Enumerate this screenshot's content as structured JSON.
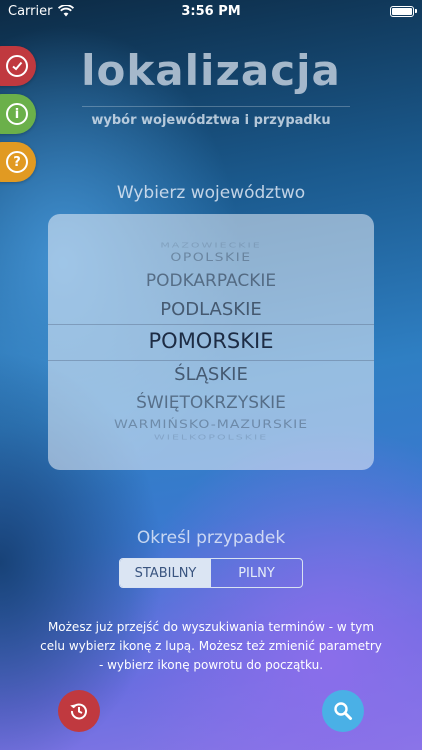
{
  "status_bar": {
    "carrier": "Carrier",
    "time": "3:56 PM"
  },
  "side_buttons": [
    {
      "icon": "checkmark-icon",
      "color": "#c0393f"
    },
    {
      "icon": "info-icon",
      "glyph": "i",
      "color": "#6bb04a"
    },
    {
      "icon": "question-icon",
      "glyph": "?",
      "color": "#e19a22"
    }
  ],
  "header": {
    "title": "lokalizacja",
    "subtitle": "wybór województwa i przypadku"
  },
  "province_section": {
    "label": "Wybierz województwo"
  },
  "picker": {
    "items": [
      "MAZOWIECKIE",
      "OPOLSKIE",
      "PODKARPACKIE",
      "PODLASKIE",
      "POMORSKIE",
      "ŚLĄSKIE",
      "ŚWIĘTOKRZYSKIE",
      "WARMIŃSKO-MAZURSKIE",
      "WIELKOPOLSKIE"
    ],
    "selected": "POMORSKIE"
  },
  "case_section": {
    "label": "Określ przypadek"
  },
  "segmented": {
    "options": [
      "STABILNY",
      "PILNY"
    ],
    "selected": "STABILNY"
  },
  "info": {
    "text": "Możesz już przejść do wyszukiwania terminów - w tym celu wybierz ikonę z lupą. Możesz też zmienić parametry - wybierz ikonę powrotu do początku."
  },
  "bottom_buttons": {
    "reset": {
      "icon": "restart-icon",
      "color": "#c0393f"
    },
    "search": {
      "icon": "search-icon",
      "color": "#4ab0e6"
    }
  }
}
